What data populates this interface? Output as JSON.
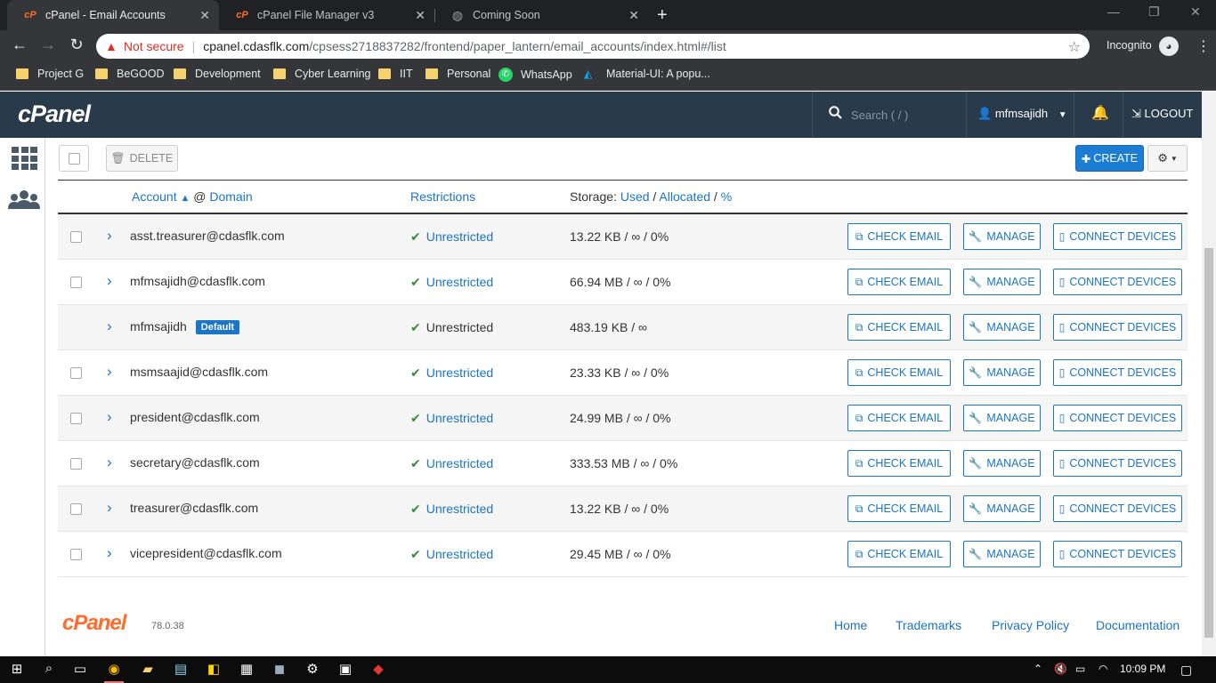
{
  "browser": {
    "tabs": [
      {
        "title": "cPanel - Email Accounts",
        "active": true
      },
      {
        "title": "cPanel File Manager v3",
        "active": false
      },
      {
        "title": "Coming Soon",
        "active": false
      }
    ],
    "security_label": "Not secure",
    "url_host": "cpanel.cdasflk.com",
    "url_path": "/cpsess2718837282/frontend/paper_lantern/email_accounts/index.html#/list",
    "incognito_label": "Incognito",
    "bookmarks": [
      "Project G",
      "BeGOOD",
      "Development",
      "Cyber Learning",
      "IIT",
      "Personal",
      "WhatsApp",
      "Material-UI: A popu..."
    ]
  },
  "header": {
    "logo": "cPanel",
    "search_placeholder": "Search ( / )",
    "username": "mfmsajidh",
    "logout_label": "LOGOUT"
  },
  "actions": {
    "delete_label": "DELETE",
    "create_label": "CREATE"
  },
  "table": {
    "col_account": "Account",
    "col_at": "@",
    "col_domain": "Domain",
    "col_restrictions": "Restrictions",
    "col_storage_prefix": "Storage:",
    "col_used": "Used",
    "col_allocated": "Allocated",
    "col_percent": "%",
    "slash": "/",
    "default_badge": "Default",
    "rows": [
      {
        "account": "asst.treasurer@cdasflk.com",
        "restriction": "Unrestricted",
        "storage": "13.22 KB / ∞ / 0%"
      },
      {
        "account": "mfmsajidh@cdasflk.com",
        "restriction": "Unrestricted",
        "storage": "66.94 MB / ∞ / 0%"
      },
      {
        "account": "mfmsajidh",
        "restriction": "Unrestricted",
        "storage": "483.19 KB / ∞"
      },
      {
        "account": "msmsaajid@cdasflk.com",
        "restriction": "Unrestricted",
        "storage": "23.33 KB / ∞ / 0%"
      },
      {
        "account": "president@cdasflk.com",
        "restriction": "Unrestricted",
        "storage": "24.99 MB / ∞ / 0%"
      },
      {
        "account": "secretary@cdasflk.com",
        "restriction": "Unrestricted",
        "storage": "333.53 MB / ∞ / 0%"
      },
      {
        "account": "treasurer@cdasflk.com",
        "restriction": "Unrestricted",
        "storage": "13.22 KB / ∞ / 0%"
      },
      {
        "account": "vicepresident@cdasflk.com",
        "restriction": "Unrestricted",
        "storage": "29.45 MB / ∞ / 0%"
      }
    ],
    "btn_check_email": "CHECK EMAIL",
    "btn_manage": "MANAGE",
    "btn_connect": "CONNECT DEVICES"
  },
  "footer": {
    "logo": "cPanel",
    "version": "78.0.38",
    "links": [
      "Home",
      "Trademarks",
      "Privacy Policy",
      "Documentation"
    ]
  },
  "taskbar": {
    "time": "10:09 PM"
  },
  "colors": {
    "header_bg": "#293a4a",
    "link_blue": "#1b74c5",
    "create_blue": "#1b7dd4",
    "brand_orange": "#ff6c2c",
    "check_green": "#3b8a3b"
  }
}
